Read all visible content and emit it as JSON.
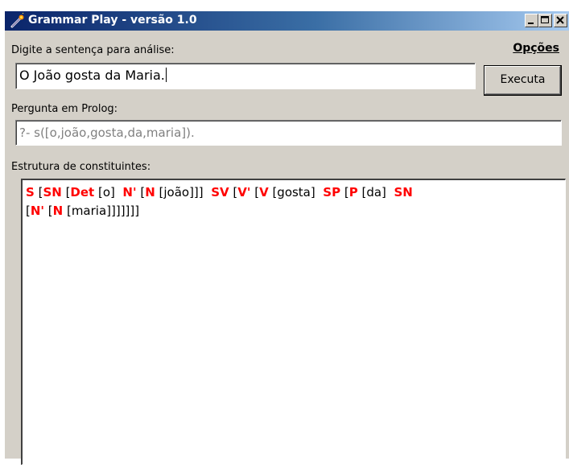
{
  "window": {
    "title": "Grammar Play - versão 1.0",
    "controls": {
      "minimize": "_",
      "maximize": "□",
      "close": "✕"
    }
  },
  "input": {
    "label": "Digite a sentença para análise:",
    "value": "O João gosta da Maria."
  },
  "menu": {
    "options": "Opções"
  },
  "execute_button": {
    "label": "Executa"
  },
  "prolog": {
    "label": "Pergunta em Prolog:",
    "value": "?- s([o,joão,gosta,da,maria])."
  },
  "structure": {
    "label": "Estrutura de constituintes:",
    "line1": [
      {
        "cat": "S"
      },
      {
        "t": " ["
      },
      {
        "cat": "SN"
      },
      {
        "t": " ["
      },
      {
        "cat": "Det"
      },
      {
        "t": " [o]  "
      },
      {
        "cat": "N'"
      },
      {
        "t": " ["
      },
      {
        "cat": "N"
      },
      {
        "t": " [joão]]]  "
      },
      {
        "cat": "SV"
      },
      {
        "t": " ["
      },
      {
        "cat": "V'"
      },
      {
        "t": " ["
      },
      {
        "cat": "V"
      },
      {
        "t": " [gosta]  "
      },
      {
        "cat": "SP"
      },
      {
        "t": " ["
      },
      {
        "cat": "P"
      },
      {
        "t": " [da]  "
      },
      {
        "cat": "SN"
      }
    ],
    "line2": [
      {
        "t": "["
      },
      {
        "cat": "N'"
      },
      {
        "t": " ["
      },
      {
        "cat": "N"
      },
      {
        "t": " [maria]]]]]]]"
      }
    ]
  },
  "colors": {
    "titlebar_start": "#0a246a",
    "titlebar_end": "#a6caf0",
    "category": "#ff0000",
    "window_bg": "#d4d0c8"
  }
}
